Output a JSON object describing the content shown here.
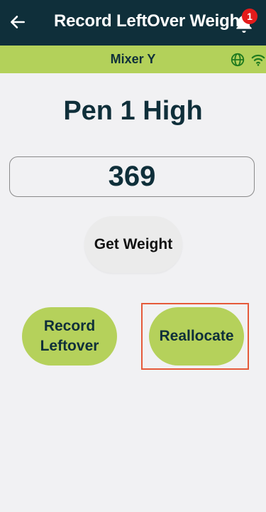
{
  "header": {
    "title": "Record LeftOver Weight",
    "back_icon": "arrow-left-icon",
    "notification_icon": "bell-icon",
    "notification_count": "1"
  },
  "subheader": {
    "mixer_label": "Mixer Y",
    "status_icons": [
      "globe-icon",
      "wifi-icon"
    ],
    "status_color": "#1f7a1f"
  },
  "main": {
    "pen_title": "Pen 1 High",
    "weight_value": "369",
    "get_weight_label": "Get Weight",
    "record_leftover_label": "Record Leftover",
    "reallocate_label": "Reallocate"
  },
  "colors": {
    "header_bg": "#0f2f3a",
    "accent_green": "#b3d15a",
    "badge_red": "#e31b1b",
    "highlight": "#e55a3a"
  }
}
